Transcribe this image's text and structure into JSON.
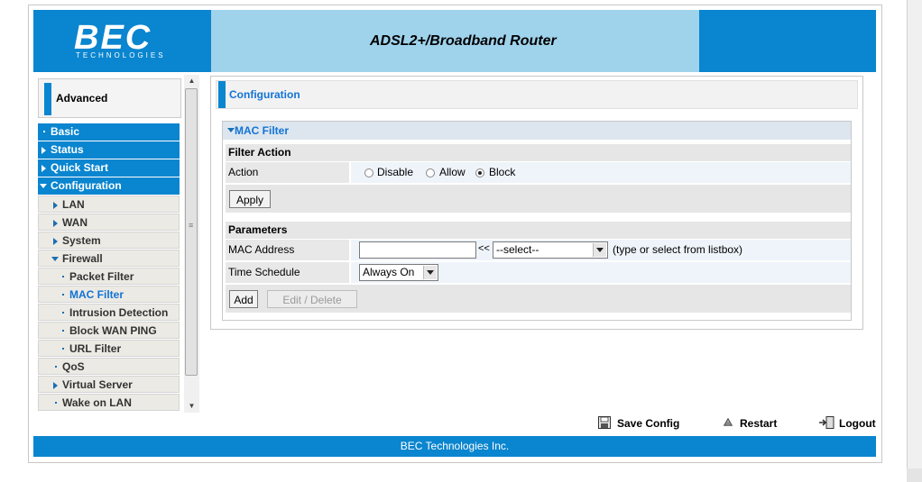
{
  "header": {
    "logo_word": "BEC",
    "logo_sub": "TECHNOLOGIES",
    "title": "ADSL2+/Broadband Router"
  },
  "sidebar": {
    "section": "Advanced",
    "items": [
      {
        "label": "Basic",
        "level": "main",
        "marker": "dot"
      },
      {
        "label": "Status",
        "level": "main",
        "marker": "arrow"
      },
      {
        "label": "Quick Start",
        "level": "main",
        "marker": "arrow"
      },
      {
        "label": "Configuration",
        "level": "main",
        "marker": "open"
      },
      {
        "label": "LAN",
        "level": "sub1",
        "marker": "arrow"
      },
      {
        "label": "WAN",
        "level": "sub1",
        "marker": "arrow"
      },
      {
        "label": "System",
        "level": "sub1",
        "marker": "arrow"
      },
      {
        "label": "Firewall",
        "level": "sub1",
        "marker": "open"
      },
      {
        "label": "Packet Filter",
        "level": "sub2",
        "marker": "dot"
      },
      {
        "label": "MAC Filter",
        "level": "sub2",
        "marker": "dot",
        "active": true
      },
      {
        "label": "Intrusion Detection",
        "level": "sub2",
        "marker": "dot"
      },
      {
        "label": "Block WAN PING",
        "level": "sub2",
        "marker": "dot"
      },
      {
        "label": "URL Filter",
        "level": "sub2",
        "marker": "dot"
      },
      {
        "label": "QoS",
        "level": "sub1",
        "marker": "dot"
      },
      {
        "label": "Virtual Server",
        "level": "sub1",
        "marker": "arrow"
      },
      {
        "label": "Wake on LAN",
        "level": "sub1",
        "marker": "dot"
      }
    ]
  },
  "panel": {
    "title": "Configuration",
    "box_title": "MAC Filter",
    "filter_action": {
      "heading": "Filter Action",
      "action_label": "Action",
      "options": [
        "Disable",
        "Allow",
        "Block"
      ],
      "selected": "Block",
      "apply": "Apply"
    },
    "parameters": {
      "heading": "Parameters",
      "mac_label": "MAC Address",
      "mac_value": "",
      "arrows": "<<",
      "mac_select": "--select--",
      "hint": "(type or select from listbox)",
      "schedule_label": "Time Schedule",
      "schedule_value": "Always On",
      "add": "Add",
      "edit_delete": "Edit / Delete"
    }
  },
  "footer": {
    "save": "Save Config",
    "restart": "Restart",
    "logout": "Logout",
    "company": "BEC Technologies Inc."
  },
  "colors": {
    "brand_blue": "#0a85cf",
    "light_blue": "#9fd3ec",
    "link_blue": "#1273d6"
  }
}
